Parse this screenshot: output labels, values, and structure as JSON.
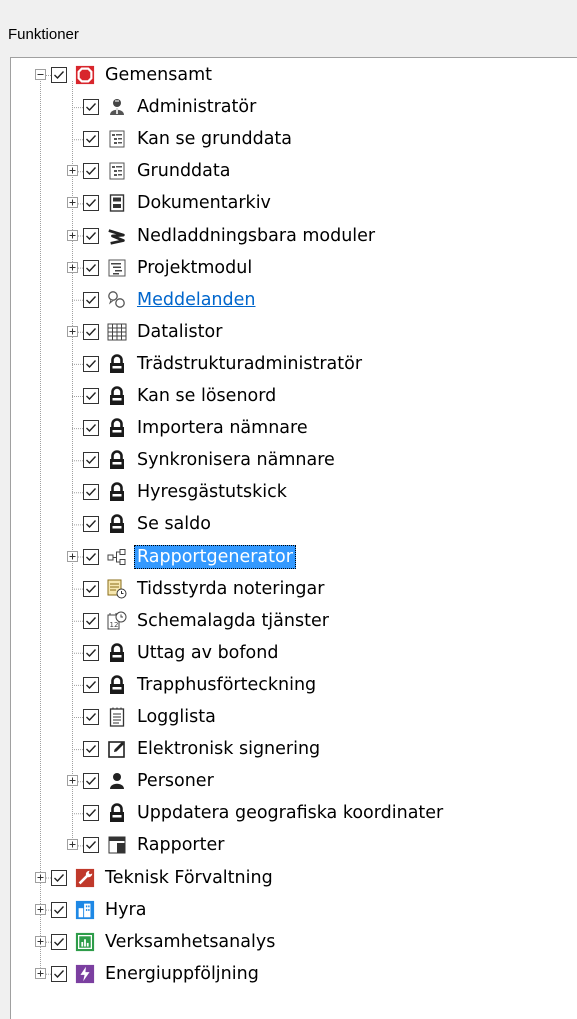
{
  "panel": {
    "title": "Funktioner"
  },
  "tree": [
    {
      "label": "Gemensamt",
      "level": 0,
      "expander": "minus",
      "icon": "stop-octagon-icon",
      "checked": true
    },
    {
      "label": "Administratör",
      "level": 1,
      "expander": "none",
      "icon": "admin-user-icon",
      "checked": true
    },
    {
      "label": "Kan se grunddata",
      "level": 1,
      "expander": "none",
      "icon": "document-list-icon",
      "checked": true
    },
    {
      "label": "Grunddata",
      "level": 1,
      "expander": "plus",
      "icon": "document-list-icon",
      "checked": true
    },
    {
      "label": "Dokumentarkiv",
      "level": 1,
      "expander": "plus",
      "icon": "archive-icon",
      "checked": true
    },
    {
      "label": "Nedladdningsbara moduler",
      "level": 1,
      "expander": "plus",
      "icon": "module-download-icon",
      "checked": true
    },
    {
      "label": "Projektmodul",
      "level": 1,
      "expander": "plus",
      "icon": "project-icon",
      "checked": true
    },
    {
      "label": "Meddelanden",
      "level": 1,
      "expander": "none",
      "icon": "messages-icon",
      "checked": true,
      "style": "link"
    },
    {
      "label": "Datalistor",
      "level": 1,
      "expander": "plus",
      "icon": "grid-table-icon",
      "checked": true
    },
    {
      "label": "Trädstrukturadministratör",
      "level": 1,
      "expander": "none",
      "icon": "lock-icon",
      "checked": true
    },
    {
      "label": "Kan se lösenord",
      "level": 1,
      "expander": "none",
      "icon": "lock-icon",
      "checked": true
    },
    {
      "label": "Importera nämnare",
      "level": 1,
      "expander": "none",
      "icon": "lock-icon",
      "checked": true
    },
    {
      "label": "Synkronisera nämnare",
      "level": 1,
      "expander": "none",
      "icon": "lock-icon",
      "checked": true
    },
    {
      "label": "Hyresgästutskick",
      "level": 1,
      "expander": "none",
      "icon": "lock-icon",
      "checked": true
    },
    {
      "label": "Se saldo",
      "level": 1,
      "expander": "none",
      "icon": "lock-icon",
      "checked": true
    },
    {
      "label": "Rapportgenerator",
      "level": 1,
      "expander": "plus",
      "icon": "hierarchy-icon",
      "checked": true,
      "style": "selected"
    },
    {
      "label": "Tidsstyrda noteringar",
      "level": 1,
      "expander": "none",
      "icon": "timed-note-icon",
      "checked": true
    },
    {
      "label": "Schemalagda tjänster",
      "level": 1,
      "expander": "none",
      "icon": "calendar-clock-icon",
      "checked": true
    },
    {
      "label": "Uttag av bofond",
      "level": 1,
      "expander": "none",
      "icon": "lock-icon",
      "checked": true
    },
    {
      "label": "Trapphusförteckning",
      "level": 1,
      "expander": "none",
      "icon": "lock-icon",
      "checked": true
    },
    {
      "label": "Logglista",
      "level": 1,
      "expander": "none",
      "icon": "log-icon",
      "checked": true
    },
    {
      "label": "Elektronisk signering",
      "level": 1,
      "expander": "none",
      "icon": "sign-edit-icon",
      "checked": true
    },
    {
      "label": "Personer",
      "level": 1,
      "expander": "plus",
      "icon": "person-icon",
      "checked": true
    },
    {
      "label": "Uppdatera geografiska koordinater",
      "level": 1,
      "expander": "none",
      "icon": "lock-icon",
      "checked": true
    },
    {
      "label": "Rapporter",
      "level": 1,
      "expander": "plus",
      "icon": "reports-icon",
      "checked": true
    },
    {
      "label": "Teknisk Förvaltning",
      "level": 0,
      "expander": "plus",
      "icon": "wrench-icon",
      "checked": true
    },
    {
      "label": "Hyra",
      "level": 0,
      "expander": "plus",
      "icon": "buildings-icon",
      "checked": true
    },
    {
      "label": "Verksamhetsanalys",
      "level": 0,
      "expander": "plus",
      "icon": "bar-chart-icon",
      "checked": true
    },
    {
      "label": "Energiuppföljning",
      "level": 0,
      "expander": "plus",
      "icon": "lightning-icon",
      "checked": true
    }
  ],
  "colors": {
    "selected_bg": "#3399ff",
    "link": "#0066cc",
    "gemensamt": "#d8262c",
    "teknisk": "#c0392b",
    "hyra": "#1e88e5",
    "verksamhet": "#2e9d4a",
    "energi": "#7b3fa0"
  }
}
